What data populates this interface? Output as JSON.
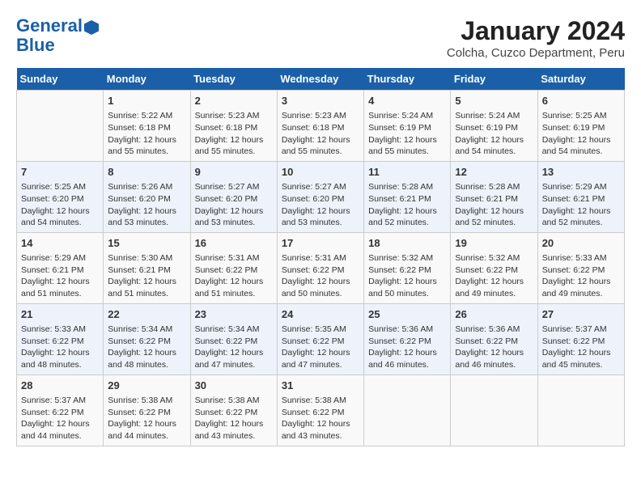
{
  "header": {
    "logo_line1": "General",
    "logo_line2": "Blue",
    "title": "January 2024",
    "subtitle": "Colcha, Cuzco Department, Peru"
  },
  "weekdays": [
    "Sunday",
    "Monday",
    "Tuesday",
    "Wednesday",
    "Thursday",
    "Friday",
    "Saturday"
  ],
  "weeks": [
    [
      {
        "day": "",
        "info": ""
      },
      {
        "day": "1",
        "info": "Sunrise: 5:22 AM\nSunset: 6:18 PM\nDaylight: 12 hours\nand 55 minutes."
      },
      {
        "day": "2",
        "info": "Sunrise: 5:23 AM\nSunset: 6:18 PM\nDaylight: 12 hours\nand 55 minutes."
      },
      {
        "day": "3",
        "info": "Sunrise: 5:23 AM\nSunset: 6:18 PM\nDaylight: 12 hours\nand 55 minutes."
      },
      {
        "day": "4",
        "info": "Sunrise: 5:24 AM\nSunset: 6:19 PM\nDaylight: 12 hours\nand 55 minutes."
      },
      {
        "day": "5",
        "info": "Sunrise: 5:24 AM\nSunset: 6:19 PM\nDaylight: 12 hours\nand 54 minutes."
      },
      {
        "day": "6",
        "info": "Sunrise: 5:25 AM\nSunset: 6:19 PM\nDaylight: 12 hours\nand 54 minutes."
      }
    ],
    [
      {
        "day": "7",
        "info": "Sunrise: 5:25 AM\nSunset: 6:20 PM\nDaylight: 12 hours\nand 54 minutes."
      },
      {
        "day": "8",
        "info": "Sunrise: 5:26 AM\nSunset: 6:20 PM\nDaylight: 12 hours\nand 53 minutes."
      },
      {
        "day": "9",
        "info": "Sunrise: 5:27 AM\nSunset: 6:20 PM\nDaylight: 12 hours\nand 53 minutes."
      },
      {
        "day": "10",
        "info": "Sunrise: 5:27 AM\nSunset: 6:20 PM\nDaylight: 12 hours\nand 53 minutes."
      },
      {
        "day": "11",
        "info": "Sunrise: 5:28 AM\nSunset: 6:21 PM\nDaylight: 12 hours\nand 52 minutes."
      },
      {
        "day": "12",
        "info": "Sunrise: 5:28 AM\nSunset: 6:21 PM\nDaylight: 12 hours\nand 52 minutes."
      },
      {
        "day": "13",
        "info": "Sunrise: 5:29 AM\nSunset: 6:21 PM\nDaylight: 12 hours\nand 52 minutes."
      }
    ],
    [
      {
        "day": "14",
        "info": "Sunrise: 5:29 AM\nSunset: 6:21 PM\nDaylight: 12 hours\nand 51 minutes."
      },
      {
        "day": "15",
        "info": "Sunrise: 5:30 AM\nSunset: 6:21 PM\nDaylight: 12 hours\nand 51 minutes."
      },
      {
        "day": "16",
        "info": "Sunrise: 5:31 AM\nSunset: 6:22 PM\nDaylight: 12 hours\nand 51 minutes."
      },
      {
        "day": "17",
        "info": "Sunrise: 5:31 AM\nSunset: 6:22 PM\nDaylight: 12 hours\nand 50 minutes."
      },
      {
        "day": "18",
        "info": "Sunrise: 5:32 AM\nSunset: 6:22 PM\nDaylight: 12 hours\nand 50 minutes."
      },
      {
        "day": "19",
        "info": "Sunrise: 5:32 AM\nSunset: 6:22 PM\nDaylight: 12 hours\nand 49 minutes."
      },
      {
        "day": "20",
        "info": "Sunrise: 5:33 AM\nSunset: 6:22 PM\nDaylight: 12 hours\nand 49 minutes."
      }
    ],
    [
      {
        "day": "21",
        "info": "Sunrise: 5:33 AM\nSunset: 6:22 PM\nDaylight: 12 hours\nand 48 minutes."
      },
      {
        "day": "22",
        "info": "Sunrise: 5:34 AM\nSunset: 6:22 PM\nDaylight: 12 hours\nand 48 minutes."
      },
      {
        "day": "23",
        "info": "Sunrise: 5:34 AM\nSunset: 6:22 PM\nDaylight: 12 hours\nand 47 minutes."
      },
      {
        "day": "24",
        "info": "Sunrise: 5:35 AM\nSunset: 6:22 PM\nDaylight: 12 hours\nand 47 minutes."
      },
      {
        "day": "25",
        "info": "Sunrise: 5:36 AM\nSunset: 6:22 PM\nDaylight: 12 hours\nand 46 minutes."
      },
      {
        "day": "26",
        "info": "Sunrise: 5:36 AM\nSunset: 6:22 PM\nDaylight: 12 hours\nand 46 minutes."
      },
      {
        "day": "27",
        "info": "Sunrise: 5:37 AM\nSunset: 6:22 PM\nDaylight: 12 hours\nand 45 minutes."
      }
    ],
    [
      {
        "day": "28",
        "info": "Sunrise: 5:37 AM\nSunset: 6:22 PM\nDaylight: 12 hours\nand 44 minutes."
      },
      {
        "day": "29",
        "info": "Sunrise: 5:38 AM\nSunset: 6:22 PM\nDaylight: 12 hours\nand 44 minutes."
      },
      {
        "day": "30",
        "info": "Sunrise: 5:38 AM\nSunset: 6:22 PM\nDaylight: 12 hours\nand 43 minutes."
      },
      {
        "day": "31",
        "info": "Sunrise: 5:38 AM\nSunset: 6:22 PM\nDaylight: 12 hours\nand 43 minutes."
      },
      {
        "day": "",
        "info": ""
      },
      {
        "day": "",
        "info": ""
      },
      {
        "day": "",
        "info": ""
      }
    ]
  ]
}
